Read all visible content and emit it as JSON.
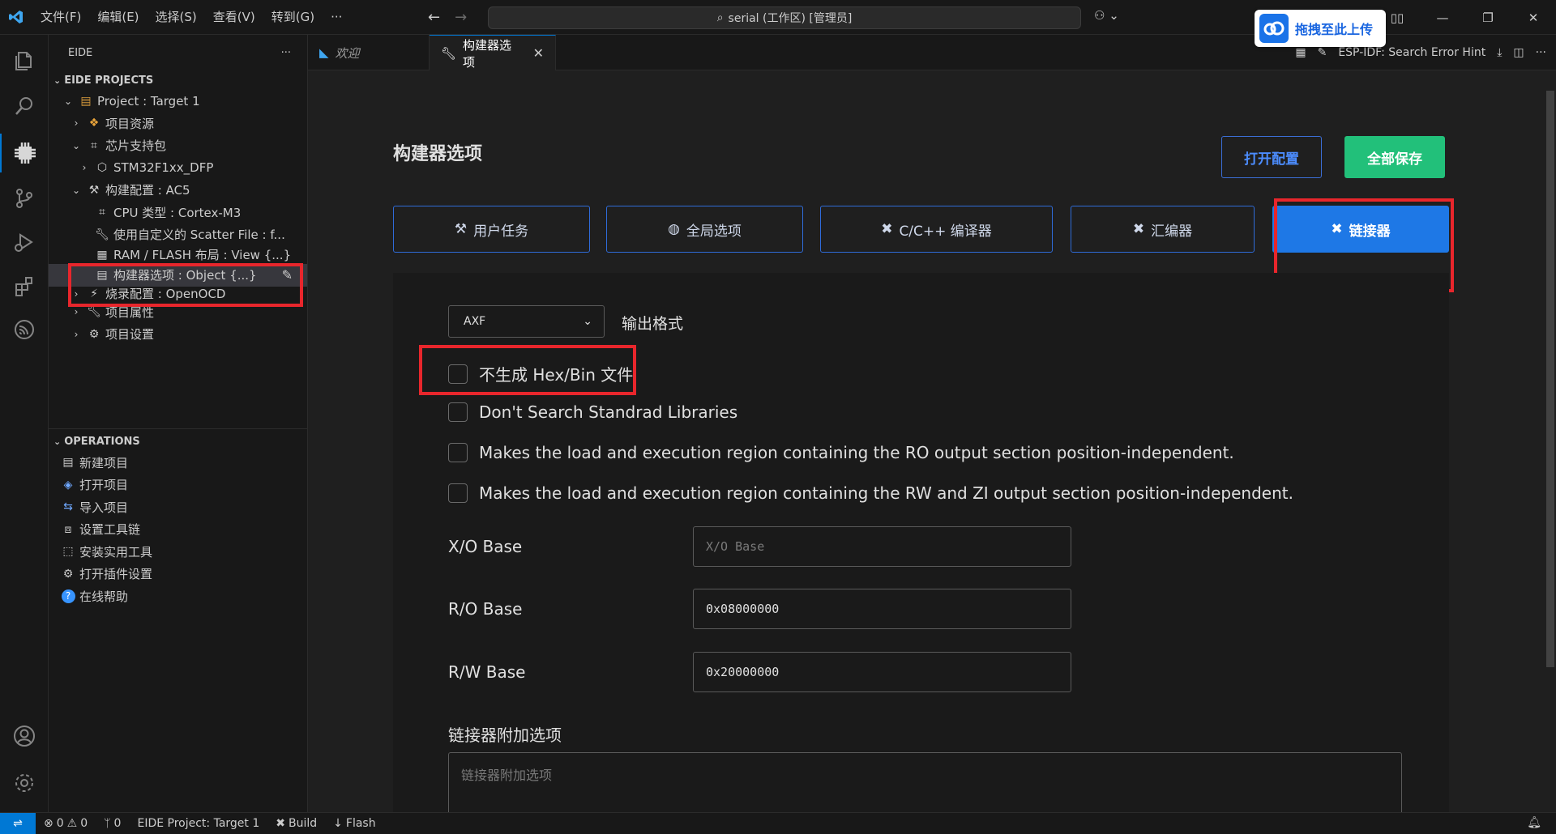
{
  "titlebar": {
    "menu": [
      "文件(F)",
      "编辑(E)",
      "选择(S)",
      "查看(V)",
      "转到(G)",
      "···"
    ],
    "search": "serial (工作区) [管理员]",
    "upload_badge": "拖拽至此上传"
  },
  "sidebar": {
    "title": "EIDE",
    "projects_header": "EIDE PROJECTS",
    "tree": [
      {
        "label": "Project : Target 1"
      },
      {
        "label": "项目资源"
      },
      {
        "label": "芯片支持包"
      },
      {
        "label": "STM32F1xx_DFP"
      },
      {
        "label": "构建配置 : AC5"
      },
      {
        "label": "CPU 类型 : Cortex-M3"
      },
      {
        "label": "使用自定义的 Scatter File : f..."
      },
      {
        "label": "RAM / FLASH 布局 : View {...}"
      },
      {
        "label": "构建器选项 : Object {...}"
      },
      {
        "label": "烧录配置 : OpenOCD"
      },
      {
        "label": "项目属性"
      },
      {
        "label": "项目设置"
      }
    ],
    "operations_header": "OPERATIONS",
    "operations": [
      {
        "label": "新建项目"
      },
      {
        "label": "打开项目"
      },
      {
        "label": "导入项目"
      },
      {
        "label": "设置工具链"
      },
      {
        "label": "安装实用工具"
      },
      {
        "label": "打开插件设置"
      },
      {
        "label": "在线帮助"
      }
    ]
  },
  "tabs": {
    "welcome": "欢迎",
    "builder": "构建器选项",
    "esp_hint": "ESP-IDF: Search Error Hint"
  },
  "editor": {
    "title": "构建器选项",
    "open_config": "打开配置",
    "save_all": "全部保存",
    "tab_buttons": [
      {
        "label": "用户任务"
      },
      {
        "label": "全局选项"
      },
      {
        "label": "C/C++ 编译器"
      },
      {
        "label": "汇编器"
      },
      {
        "label": "链接器"
      }
    ],
    "output_format": {
      "value": "AXF",
      "label": "输出格式"
    },
    "checkboxes": [
      {
        "label": "不生成 Hex/Bin 文件",
        "checked": false
      },
      {
        "label": "Don't Search Standrad Libraries",
        "checked": false
      },
      {
        "label": "Makes the load and execution region containing the RO output section position-independent.",
        "checked": false
      },
      {
        "label": "Makes the load and execution region containing the RW and ZI output section position-independent.",
        "checked": false
      }
    ],
    "fields": [
      {
        "label": "X/O Base",
        "value": "",
        "placeholder": "X/O Base"
      },
      {
        "label": "R/O Base",
        "value": "0x08000000",
        "placeholder": ""
      },
      {
        "label": "R/W Base",
        "value": "0x20000000",
        "placeholder": ""
      }
    ],
    "misc_label": "链接器附加选项",
    "misc_placeholder": "链接器附加选项"
  },
  "statusbar": {
    "errors": "0",
    "warnings": "0",
    "ports": "0",
    "project": "EIDE Project: Target 1",
    "build": "Build",
    "flash": "Flash"
  },
  "colors": {
    "accent": "#0078d4",
    "tab_active": "#1e78e6",
    "save_green": "#22c07a",
    "highlight_red": "#e8262c"
  }
}
